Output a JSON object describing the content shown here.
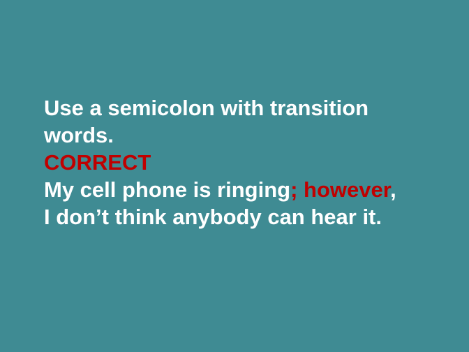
{
  "slide": {
    "rule_line1": "Use a semicolon with transition",
    "rule_line2": "words.",
    "label": "CORRECT",
    "example_part1": "My cell phone is ringing",
    "example_highlight": "; however",
    "example_comma": ",",
    "example_line2": "I don’t think anybody can hear it."
  },
  "colors": {
    "background": "#3f8b93",
    "text": "#ffffff",
    "highlight": "#c00000"
  }
}
